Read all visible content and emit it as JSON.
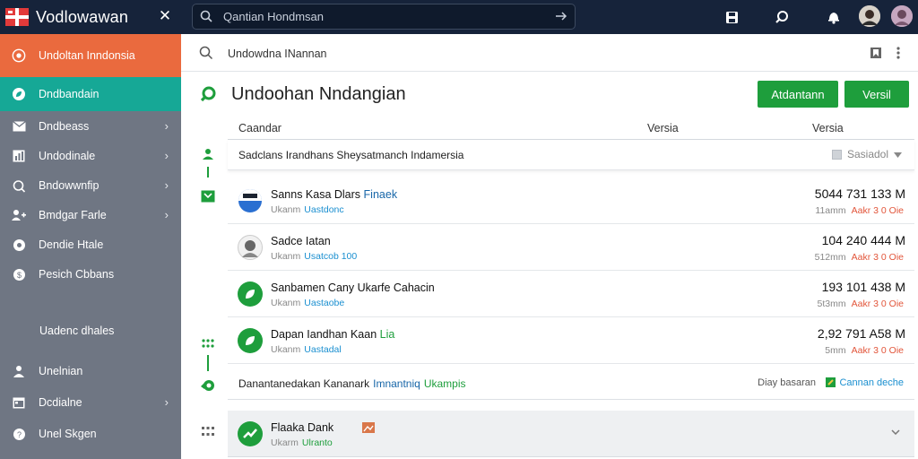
{
  "app": {
    "title": "Vodlowawan",
    "search_text": "Qantian Hondmsan"
  },
  "sidebar": {
    "items": [
      {
        "label": "Undoltan Inndonsia",
        "icon": "target-icon"
      },
      {
        "label": "Dndbandain",
        "icon": "leaf-icon"
      },
      {
        "label": "Dndbeass",
        "icon": "mail-icon"
      },
      {
        "label": "Undodinale",
        "icon": "chart-icon"
      },
      {
        "label": "Bndowwnfip",
        "icon": "search-icon"
      },
      {
        "label": "Bmdgar Farle",
        "icon": "users-icon"
      },
      {
        "label": "Dendie Htale",
        "icon": "record-icon"
      },
      {
        "label": "Pesich Cbbans",
        "icon": "coin-icon"
      }
    ],
    "section_label": "Uadenc dhales",
    "bottom_items": [
      {
        "label": "Unelnian",
        "icon": "person-icon"
      },
      {
        "label": "Dcdialne",
        "icon": "calendar-icon"
      },
      {
        "label": "Unel Skgen",
        "icon": "help-icon"
      }
    ]
  },
  "subbar": {
    "text": "Undowdna INannan"
  },
  "page": {
    "title": "Undoohan Nndangian",
    "buttons": {
      "primary": "Atdantann",
      "secondary": "Versil"
    }
  },
  "table": {
    "headers": {
      "col1": "Caandar",
      "col2": "Versia",
      "col3": "Versia"
    },
    "filter": {
      "text": "Sadclans Irandhans Sheysatmanch Indamersia",
      "select": "Sasiadol"
    },
    "rows": [
      {
        "name_a": "Sanns Kasa Dlars",
        "name_b": "Finaek",
        "meta_label": "Ukanm",
        "meta_link": "Uastdonc",
        "value": "5044 731 133 M",
        "sub_a": "11amm",
        "sub_b": "Aakr 3 0 Oie",
        "icon": "flag-icon"
      },
      {
        "name_a": "Sadce Iatan",
        "name_b": "",
        "meta_label": "Ukanm",
        "meta_link": "Usatcob 100",
        "value": "104 240 444 M",
        "sub_a": "512mm",
        "sub_b": "Aakr 3 0 Oie",
        "icon": "face-icon"
      },
      {
        "name_a": "Sanbamen Cany Ukarfe Cahacin",
        "name_b": "",
        "meta_label": "Ukanm",
        "meta_link": "Uastaobe",
        "value": "193 101 438 M",
        "sub_a": "5t3mm",
        "sub_b": "Aakr 3 0 Oie",
        "icon": "leaf-icon"
      },
      {
        "name_a": "Dapan Iandhan Kaan",
        "name_b": "Lia",
        "meta_label": "Ukanm",
        "meta_link": "Uastadal",
        "value": "2,92 791 A58 M",
        "sub_a": "5mm",
        "sub_b": "Aakr 3 0 Oie",
        "icon": "leaf-icon"
      }
    ],
    "banner": {
      "text": "Danantanedakan Kananark",
      "link1": "Imnantniq",
      "link2": "Ukampis",
      "right1": "Diay basaran",
      "right2": "Cannan deche"
    },
    "last_row": {
      "name": "Flaaka Dank",
      "meta_label": "Ukarm",
      "meta_link": "Ulranto"
    }
  },
  "colors": {
    "topbar": "#16233a",
    "sidebar": "#6f7683",
    "sidebar_active_orange": "#ea6a3e",
    "sidebar_active_teal": "#16a896",
    "accent_green": "#1e9e3c",
    "link_blue": "#1a8fd0",
    "alert_red": "#e2553a"
  }
}
